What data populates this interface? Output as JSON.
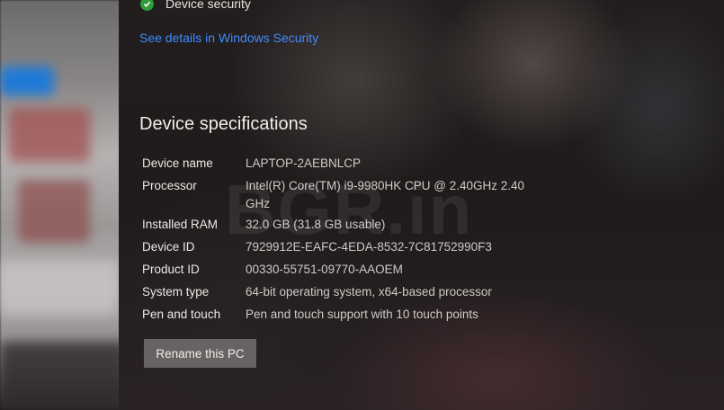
{
  "security": {
    "item_label": "Device security",
    "link_text": "See details in Windows Security"
  },
  "specs": {
    "title": "Device specifications",
    "rows": [
      {
        "label": "Device name",
        "value": "LAPTOP-2AEBNLCP"
      },
      {
        "label": "Processor",
        "value": "Intel(R) Core(TM) i9-9980HK CPU @ 2.40GHz   2.40 GHz"
      },
      {
        "label": "Installed RAM",
        "value": "32.0 GB (31.8 GB usable)"
      },
      {
        "label": "Device ID",
        "value": "7929912E-EAFC-4EDA-8532-7C81752990F3"
      },
      {
        "label": "Product ID",
        "value": "00330-55751-09770-AAOEM"
      },
      {
        "label": "System type",
        "value": "64-bit operating system, x64-based processor"
      },
      {
        "label": "Pen and touch",
        "value": "Pen and touch support with 10 touch points"
      }
    ],
    "rename_button": "Rename this PC"
  },
  "watermark": "BGR.in",
  "colors": {
    "link": "#3e8cff",
    "check": "#2e9d3c",
    "button_bg": "#686262"
  },
  "icons": {
    "security_status": "check-circle-icon"
  }
}
